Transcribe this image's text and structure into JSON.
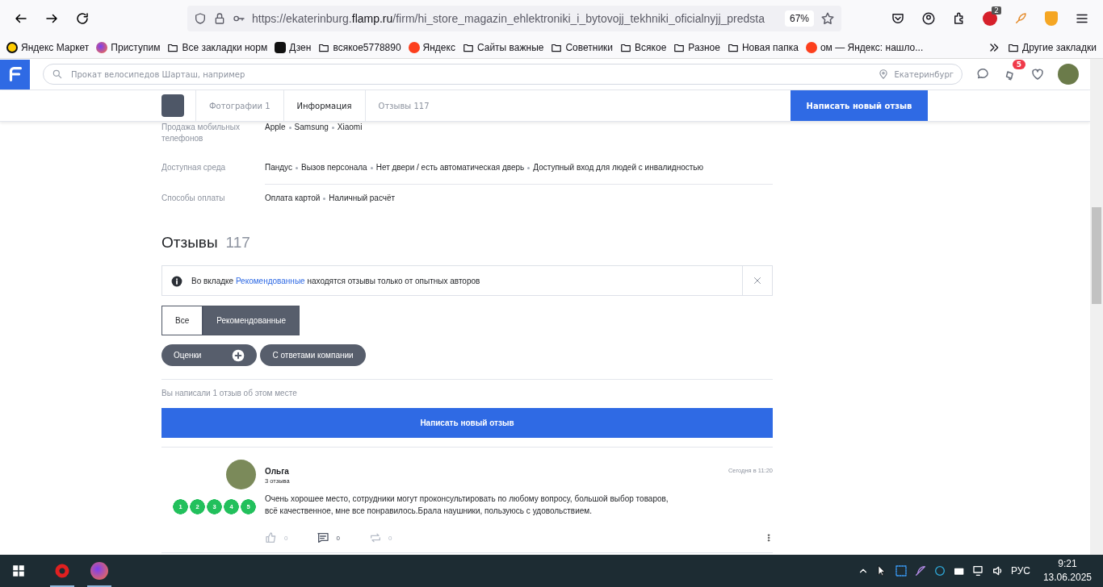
{
  "browser": {
    "url": "https://ekaterinburg.**flamp.ru**/firm/hi_store_magazin_ehlektroniki_i_bytovojj_tekhniki_oficialnyjj_predsta",
    "zoom": "67%",
    "extension_badge": "2",
    "bookmarks": [
      {
        "label": "Яндекс Маркет",
        "kind": "market"
      },
      {
        "label": "Приступим",
        "kind": "firefox"
      },
      {
        "label": "Все закладки норм",
        "kind": "folder"
      },
      {
        "label": "Дзен",
        "kind": "dzen"
      },
      {
        "label": "всякое5778890",
        "kind": "folder"
      },
      {
        "label": "Яндекс",
        "kind": "yandex"
      },
      {
        "label": "Сайты важные",
        "kind": "folder"
      },
      {
        "label": "Советники",
        "kind": "folder"
      },
      {
        "label": "Всякое",
        "kind": "folder"
      },
      {
        "label": "Разное",
        "kind": "folder"
      },
      {
        "label": "Новая папка",
        "kind": "folder"
      },
      {
        "label": "ом — Яндекс: нашло...",
        "kind": "yandex"
      }
    ],
    "other_bookmarks": "Другие закладки"
  },
  "site": {
    "search": {
      "placeholder": "Прокат велосипедов Шарташ, например",
      "city": "Екатеринбург"
    },
    "notifications": "5"
  },
  "subnav": {
    "tabs": [
      {
        "label": "Фотографии 1",
        "selected": false
      },
      {
        "label": "Информация",
        "selected": true
      },
      {
        "label": "Отзывы 117",
        "selected": false
      }
    ],
    "button": "Написать новый отзыв"
  },
  "info_rows": [
    {
      "label": "Продажа мобильных телефонов",
      "values": [
        "Apple",
        "Samsung",
        "Xiaomi"
      ]
    },
    {
      "label": "Доступная среда",
      "values": [
        "Пандус",
        "Вызов персонала",
        "Нет двери / есть автоматическая дверь",
        "Доступный вход для людей с инвалидностью"
      ]
    },
    {
      "label": "Способы оплаты",
      "values": [
        "Оплата картой",
        "Наличный расчёт"
      ]
    }
  ],
  "reviews": {
    "title": "Отзывы",
    "count": "117",
    "notice": {
      "before": "Во вкладке",
      "link": "Рекомендованные",
      "after": "находятся отзывы только от опытных авторов"
    },
    "tabs": [
      {
        "label": "Все",
        "selected": false
      },
      {
        "label": "Рекомендованные",
        "selected": true
      }
    ],
    "filters": [
      {
        "label": "Оценки",
        "kind": "expand"
      },
      {
        "label": "С ответами компании",
        "kind": "plain"
      }
    ],
    "written_note": "Вы написали 1 отзыв об этом месте",
    "write_button": "Написать новый отзыв",
    "items": [
      {
        "author": "Ольга",
        "author_reviews": "3 отзыва",
        "date": "Сегодня в 11:20",
        "rating_labels": [
          "1",
          "2",
          "3",
          "4",
          "5"
        ],
        "stars": 5,
        "text": "Очень хорошее место, сотрудники могут проконсультировать по любому вопросу, большой выбор товаров, всё качественное, мне все понравилось.Брала наушники, пользуюсь с удовольствием.",
        "likes": "0",
        "comments": "0",
        "reposts": "0"
      }
    ]
  },
  "taskbar": {
    "language": "РУС",
    "time": "9:21",
    "date": "13.06.2025"
  }
}
